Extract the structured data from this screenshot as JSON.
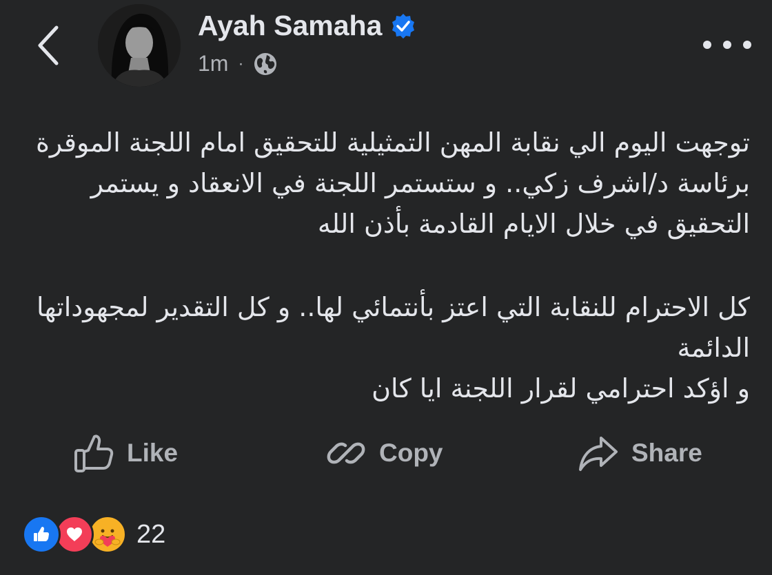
{
  "header": {
    "back_icon": "chevron-left-icon",
    "author_name": "Ayah Samaha",
    "verified_icon": "verified-badge-icon",
    "verified_color": "#1877f2",
    "timestamp": "1m",
    "separator": "·",
    "privacy_icon": "globe-icon",
    "more_icon": "more-horizontal-icon"
  },
  "post": {
    "paragraphs": [
      "توجهت اليوم الي نقابة المهن التمثيلية للتحقيق امام اللجنة الموقرة برئاسة د/اشرف زكي.. و ستستمر اللجنة في الانعقاد و يستمر التحقيق في خلال الايام القادمة بأذن الله",
      "كل الاحترام للنقابة التي اعتز بأنتمائي لها.. و كل التقدير لمجهوداتها الدائمة",
      "و اؤكد احترامي لقرار اللجنة ايا كان"
    ]
  },
  "actions": {
    "like_label": "Like",
    "copy_label": "Copy",
    "share_label": "Share",
    "like_icon": "thumbs-up-icon",
    "copy_icon": "link-icon",
    "share_icon": "share-arrow-icon"
  },
  "reactions": {
    "count": "22",
    "types": [
      "like",
      "love",
      "care"
    ],
    "colors": {
      "like": "#1877f2",
      "love": "#f33e58",
      "care": "#f7b125"
    }
  },
  "theme": {
    "background": "#242526",
    "text_primary": "#e4e6eb",
    "text_secondary": "#b0b3b8"
  }
}
